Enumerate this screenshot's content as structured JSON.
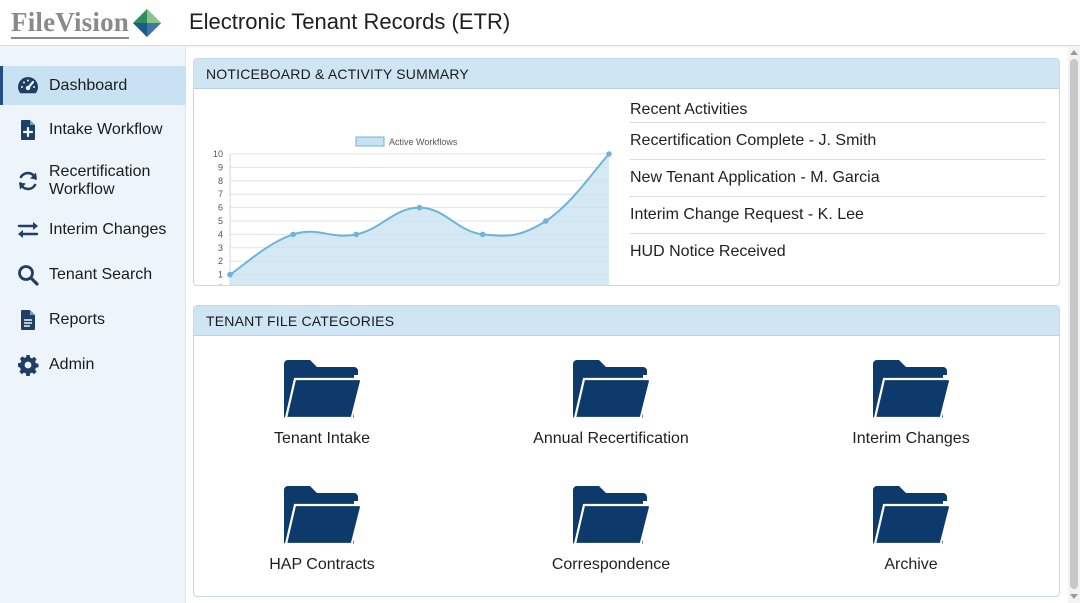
{
  "header": {
    "logo_text": "FileVision",
    "app_title": "Electronic Tenant Records (ETR)"
  },
  "sidebar": {
    "items": [
      {
        "label": "Dashboard",
        "icon": "dashboard-icon",
        "active": true
      },
      {
        "label": "Intake Workflow",
        "icon": "file-plus-icon"
      },
      {
        "label": "Recertification Workflow",
        "line1": "Recertification",
        "line2": "Workflow",
        "icon": "refresh-icon"
      },
      {
        "label": "Interim Changes",
        "icon": "swap-arrows-icon"
      },
      {
        "label": "Tenant Search",
        "icon": "search-icon"
      },
      {
        "label": "Reports",
        "icon": "document-icon"
      },
      {
        "label": "Admin",
        "icon": "gear-icon"
      }
    ]
  },
  "noticeboard": {
    "title": "NOTICEBOARD & ACTIVITY SUMMARY",
    "recent_title": "Recent Activities",
    "recent_items": [
      "Recertification Complete - J. Smith",
      "New Tenant Application - M. Garcia",
      "Interim Change Request - K. Lee",
      "HUD Notice Received"
    ]
  },
  "chart_data": {
    "type": "area",
    "series": [
      {
        "name": "Active Workflows",
        "values": [
          1,
          4,
          4,
          6,
          4,
          5,
          10
        ]
      }
    ],
    "x": [
      1,
      2,
      3,
      4,
      5,
      6,
      7
    ],
    "ylim": [
      0,
      10
    ],
    "yticks": [
      "0",
      "1",
      "2",
      "3",
      "4",
      "5",
      "6",
      "7",
      "8",
      "9",
      "10"
    ],
    "grid": true,
    "legend": "top-center",
    "colors": {
      "line": "#6fb3d8",
      "fill": "#c7e2f2"
    }
  },
  "categories": {
    "title": "TENANT FILE CATEGORIES",
    "items": [
      {
        "label": "Tenant Intake",
        "icon": "folder-icon"
      },
      {
        "label": "Annual Recertification",
        "icon": "folder-icon"
      },
      {
        "label": "Interim Changes",
        "icon": "folder-icon"
      },
      {
        "label": "HAP Contracts",
        "icon": "folder-icon"
      },
      {
        "label": "Correspondence",
        "icon": "folder-icon"
      },
      {
        "label": "Archive",
        "icon": "folder-icon"
      }
    ],
    "folder_color": "#0d3a6a"
  },
  "colors": {
    "accent": "#1f4f86",
    "sidebar_bg": "#edf5fb",
    "panel_header": "#cfe5f4"
  }
}
